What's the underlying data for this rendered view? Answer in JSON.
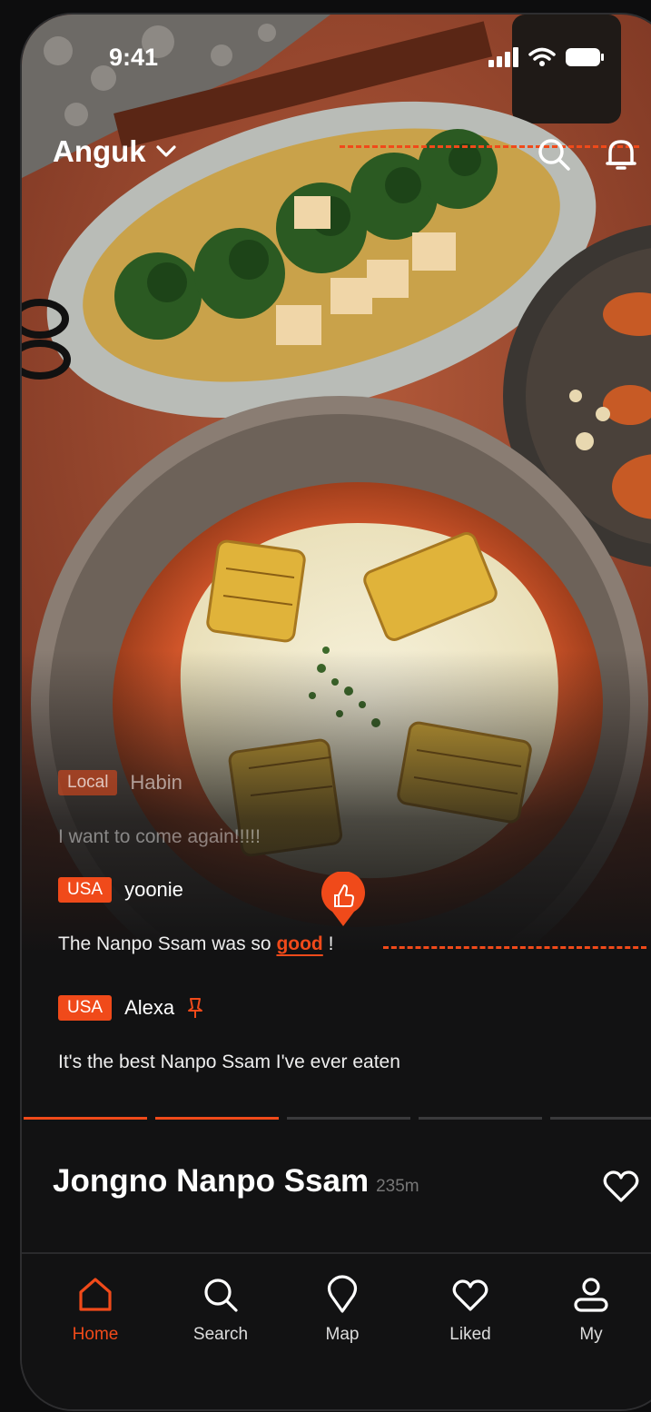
{
  "status": {
    "time": "9:41"
  },
  "header": {
    "location": "Anguk"
  },
  "comments": [
    {
      "tag": "Local",
      "user": "Habin",
      "text": "I want to come again!!!!!"
    },
    {
      "tag": "USA",
      "user": "yoonie",
      "text_before": "The Nanpo Ssam was so ",
      "highlight": "good",
      "text_after": " !"
    },
    {
      "tag": "USA",
      "user": "Alexa",
      "text": "It's the best Nanpo Ssam I've ever eaten"
    }
  ],
  "progress": {
    "segments": 5,
    "active": 2
  },
  "restaurant": {
    "name": "Jongno Nanpo Ssam",
    "distance": "235m"
  },
  "nav": [
    {
      "label": "Home",
      "icon": "home-icon",
      "active": true
    },
    {
      "label": "Search",
      "icon": "search-icon",
      "active": false
    },
    {
      "label": "Map",
      "icon": "map-pin-icon",
      "active": false
    },
    {
      "label": "Liked",
      "icon": "heart-icon",
      "active": false
    },
    {
      "label": "My",
      "icon": "user-icon",
      "active": false
    }
  ],
  "colors": {
    "accent": "#f04a1a",
    "background": "#121213"
  }
}
